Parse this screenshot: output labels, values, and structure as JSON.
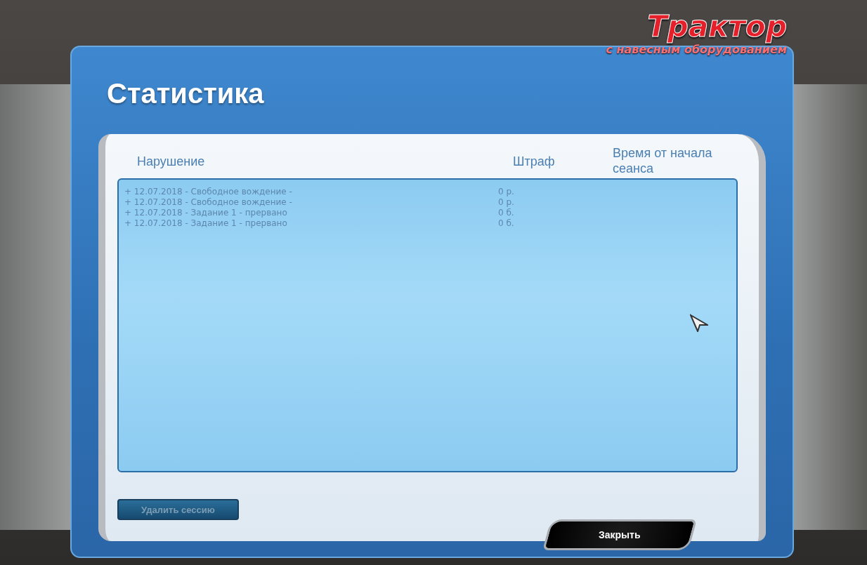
{
  "logo": {
    "title": "Трактор",
    "subtitle": "с навесным оборудованием"
  },
  "title": "Статистика",
  "table": {
    "columns": [
      "Нарушение",
      "Штраф",
      "Время от начала сеанса"
    ],
    "rows": [
      {
        "violation": "+ 12.07.2018 - Свободное вождение -",
        "fine": "0 р."
      },
      {
        "violation": "+ 12.07.2018 - Свободное вождение -",
        "fine": "0 р."
      },
      {
        "violation": "+ 12.07.2018 - Задание 1 - прервано",
        "fine": "0 б."
      },
      {
        "violation": "+ 12.07.2018 - Задание 1 - прервано",
        "fine": "0 б."
      }
    ]
  },
  "delete_button": {
    "label": "Удалить сессию",
    "disabled": true
  },
  "close_button": {
    "label": "Закрыть"
  }
}
